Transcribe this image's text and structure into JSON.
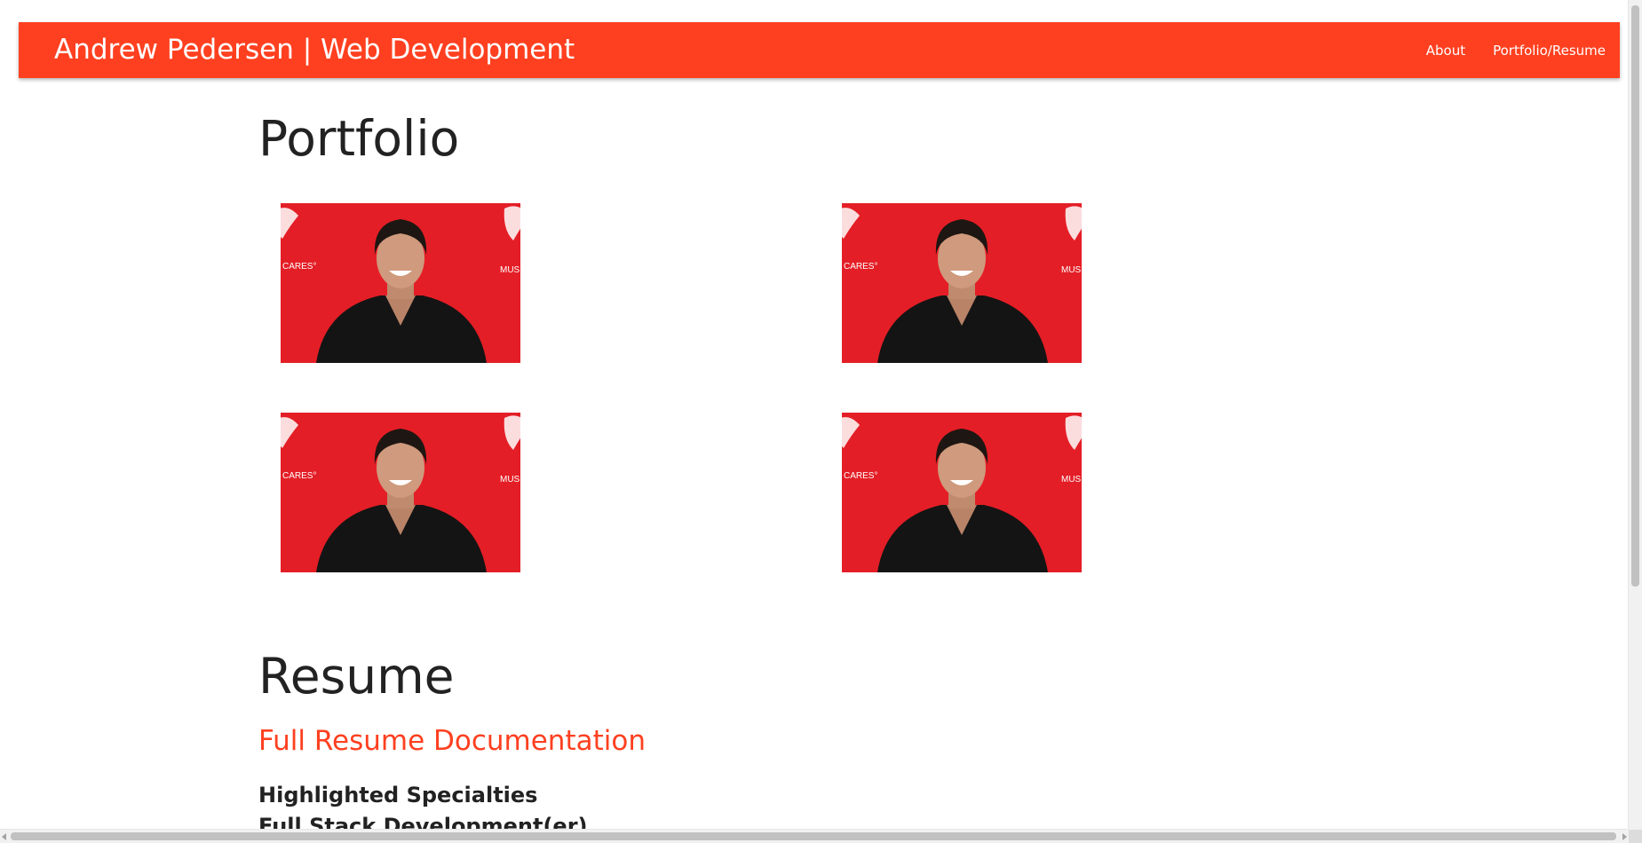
{
  "navbar": {
    "brand": "Andrew Pedersen | Web Development",
    "links": [
      "About",
      "Portfolio/Resume"
    ]
  },
  "portfolio": {
    "heading": "Portfolio",
    "items": [
      {
        "image_label": "CARES°",
        "image_label_right": "MUSI"
      },
      {
        "image_label": "CARES°",
        "image_label_right": "MUSI"
      },
      {
        "image_label": "CARES°",
        "image_label_right": "MUSI"
      },
      {
        "image_label": "CARES°",
        "image_label_right": "MUSI"
      }
    ]
  },
  "resume": {
    "heading": "Resume",
    "link": "Full Resume Documentation",
    "subheadings": [
      "Highlighted Specialties",
      "Full Stack Development(er)"
    ]
  },
  "colors": {
    "navbar": "#ff4020",
    "accent": "#ff4020",
    "photo_background": "#e41e26"
  }
}
